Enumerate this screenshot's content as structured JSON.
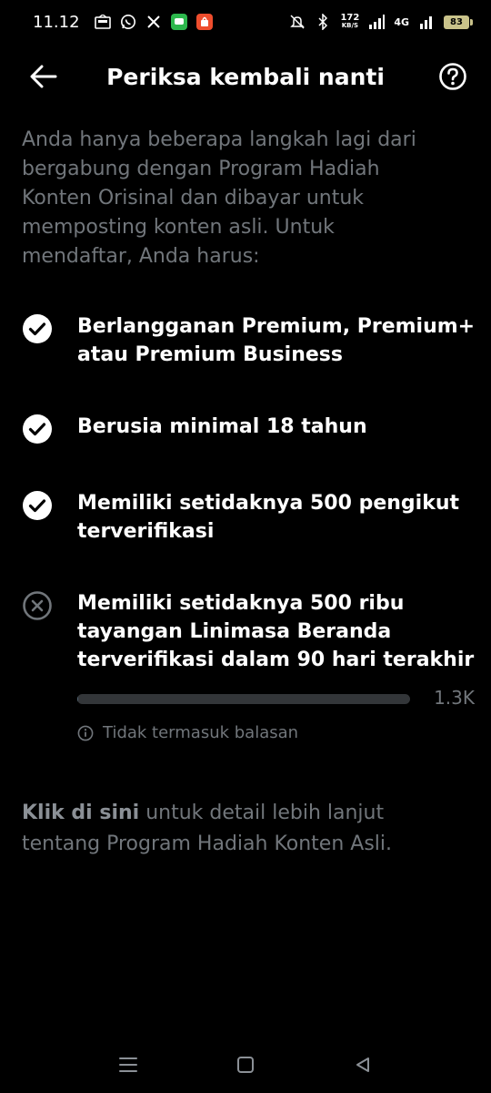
{
  "status_bar": {
    "time": "11.12",
    "net_speed_value": "172",
    "net_speed_unit": "KB/S",
    "network": "4G",
    "battery": "83",
    "icons": [
      "news-icon",
      "whatsapp-icon",
      "x-icon",
      "chat-icon",
      "shop-icon",
      "mute-icon",
      "bluetooth-icon",
      "signal-icon",
      "wifi-icon"
    ]
  },
  "header": {
    "title": "Periksa kembali nanti",
    "back_icon": "back-arrow-icon",
    "help_icon": "help-icon"
  },
  "intro": "Anda hanya beberapa langkah lagi dari bergabung dengan Program Hadiah Konten Orisinal dan dibayar untuk memposting konten asli. Untuk mendaftar, Anda harus:",
  "requirements": [
    {
      "text": "Berlangganan Premium, Premium+ atau Premium Business",
      "status": "met"
    },
    {
      "text": "Berusia minimal 18 tahun",
      "status": "met"
    },
    {
      "text": "Memiliki setidaknya 500 pengikut terverifikasi",
      "status": "met"
    },
    {
      "text": "Memiliki setidaknya 500 ribu tayangan Linimasa Beranda terverifikasi dalam 90 hari terakhir",
      "status": "unmet"
    }
  ],
  "progress": {
    "value_label": "1.3K",
    "fraction": 0.0026,
    "note": "Tidak termasuk balasan"
  },
  "footer": {
    "link_text": "Klik di sini",
    "rest_text": " untuk detail lebih lanjut tentang Program Hadiah Konten Asli."
  },
  "colors": {
    "background": "#000000",
    "text_primary": "#ffffff",
    "text_secondary": "#71767b",
    "progress_track": "#333639"
  }
}
